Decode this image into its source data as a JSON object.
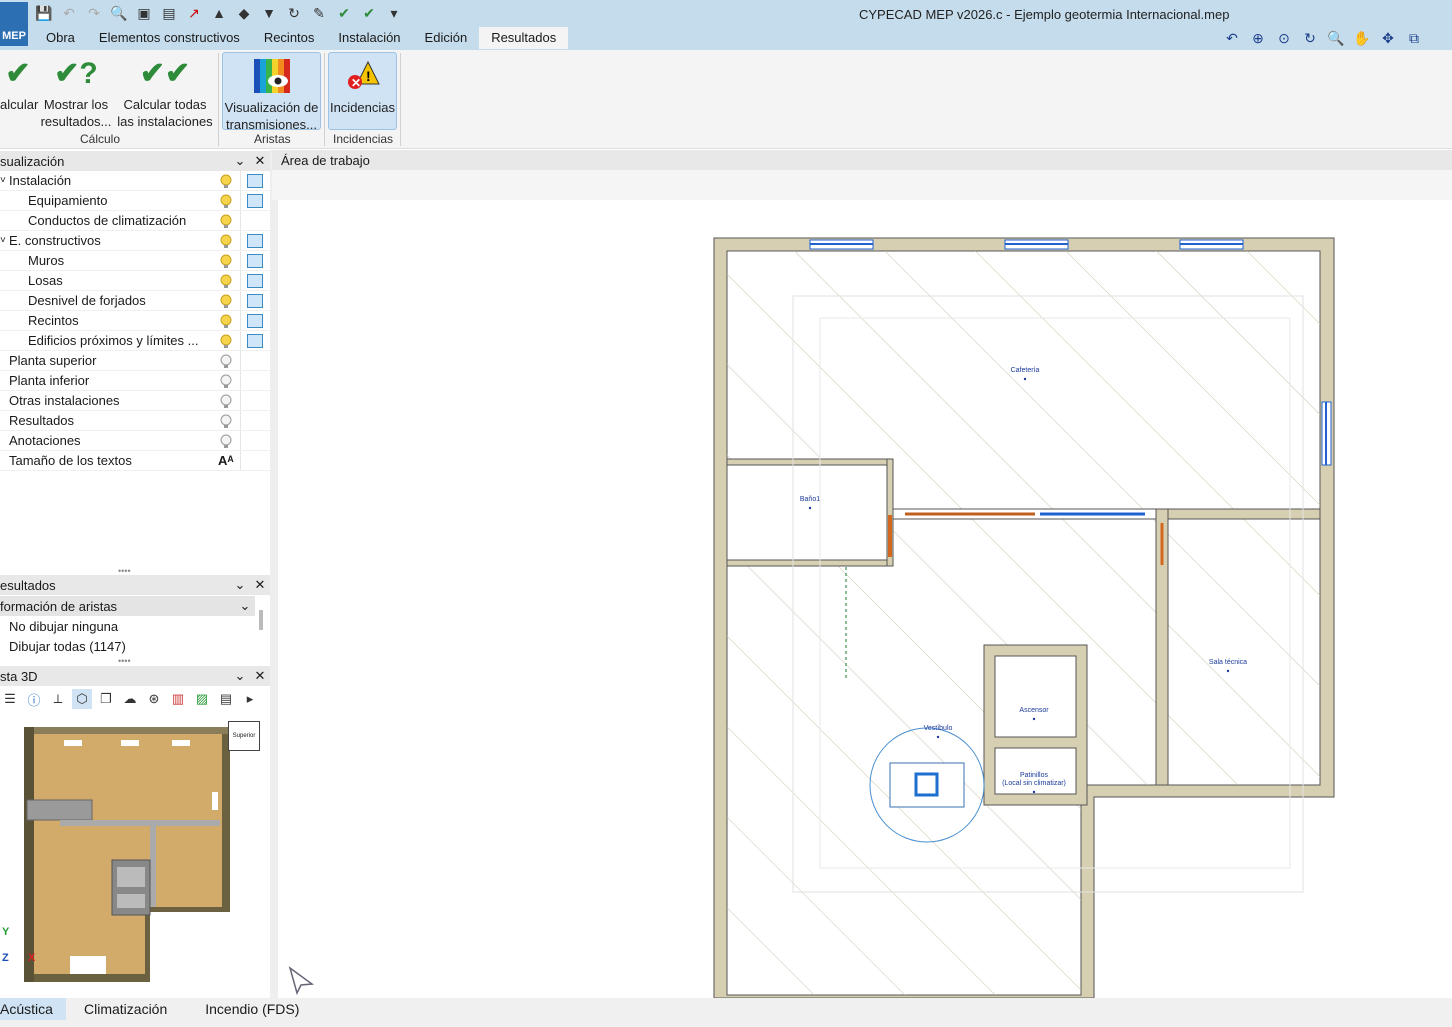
{
  "app": {
    "logo": "MEP",
    "title": "CYPECAD MEP v2026.c - Ejemplo geotermia Internacional.mep"
  },
  "menu": {
    "tabs": [
      "Obra",
      "Elementos constructivos",
      "Recintos",
      "Instalación",
      "Edición",
      "Resultados"
    ],
    "active": "Resultados"
  },
  "ribbon": {
    "buttons": [
      {
        "label1": "alcular",
        "label2": "",
        "icon": "check-icon"
      },
      {
        "label1": "Mostrar los",
        "label2": "resultados...",
        "icon": "check-question-icon"
      },
      {
        "label1": "Calcular todas",
        "label2": "las instalaciones",
        "icon": "double-check-icon"
      },
      {
        "label1": "Visualización de",
        "label2": "transmisiones...",
        "icon": "rainbow-eye-icon"
      },
      {
        "label1": "Incidencias",
        "label2": "",
        "icon": "warning-error-icon"
      }
    ],
    "groups": [
      "Cálculo",
      "Aristas",
      "Incidencias"
    ]
  },
  "panels": {
    "visualizacion": {
      "title": "sualización",
      "items": [
        {
          "label": "Instalación",
          "indent": 0,
          "expand": "˅",
          "bulb": true,
          "layers": true
        },
        {
          "label": "Equipamiento",
          "indent": 1,
          "bulb": true,
          "layers": true
        },
        {
          "label": "Conductos de climatización",
          "indent": 1,
          "bulb": true,
          "layers": false
        },
        {
          "label": "E. constructivos",
          "indent": 0,
          "expand": "˅",
          "bulb": true,
          "layers": true
        },
        {
          "label": "Muros",
          "indent": 1,
          "bulb": true,
          "layers": true
        },
        {
          "label": "Losas",
          "indent": 1,
          "bulb": true,
          "layers": true
        },
        {
          "label": "Desnivel de forjados",
          "indent": 1,
          "bulb": true,
          "layers": true
        },
        {
          "label": "Recintos",
          "indent": 1,
          "bulb": true,
          "layers": true
        },
        {
          "label": "Edificios próximos y límites ...",
          "indent": 1,
          "bulb": true,
          "layers": true
        },
        {
          "label": "Planta superior",
          "indent": 0,
          "bulb": false,
          "layers": false
        },
        {
          "label": "Planta inferior",
          "indent": 0,
          "bulb": false,
          "layers": false
        },
        {
          "label": "Otras instalaciones",
          "indent": 0,
          "bulb": false,
          "layers": false
        },
        {
          "label": "Resultados",
          "indent": 0,
          "bulb": false,
          "layers": false
        },
        {
          "label": "Anotaciones",
          "indent": 0,
          "bulb": false,
          "layers": false
        },
        {
          "label": "Tamaño de los textos",
          "indent": 0,
          "bulb": false,
          "layers": false,
          "font": true
        }
      ]
    },
    "resultados": {
      "title": "esultados",
      "sub": "formación de aristas",
      "options": [
        "No dibujar ninguna",
        "Dibujar todas (1147)"
      ]
    },
    "vista3d": {
      "title": "sta 3D",
      "cube_label": "Superior"
    }
  },
  "workarea": {
    "title": "Área de trabajo",
    "rooms": {
      "cafeteria": "Cafetería",
      "bano": "Baño1",
      "sala": "Sala técnica",
      "ascensor": "Ascensor",
      "patinillos1": "Patinillos",
      "patinillos2": "(Local sin climatizar)",
      "vestibulo": "Vestíbulo"
    }
  },
  "bottom": {
    "tabs": [
      "Acústica",
      "Climatización",
      "Incendio (FDS)"
    ],
    "active": "Acústica"
  }
}
